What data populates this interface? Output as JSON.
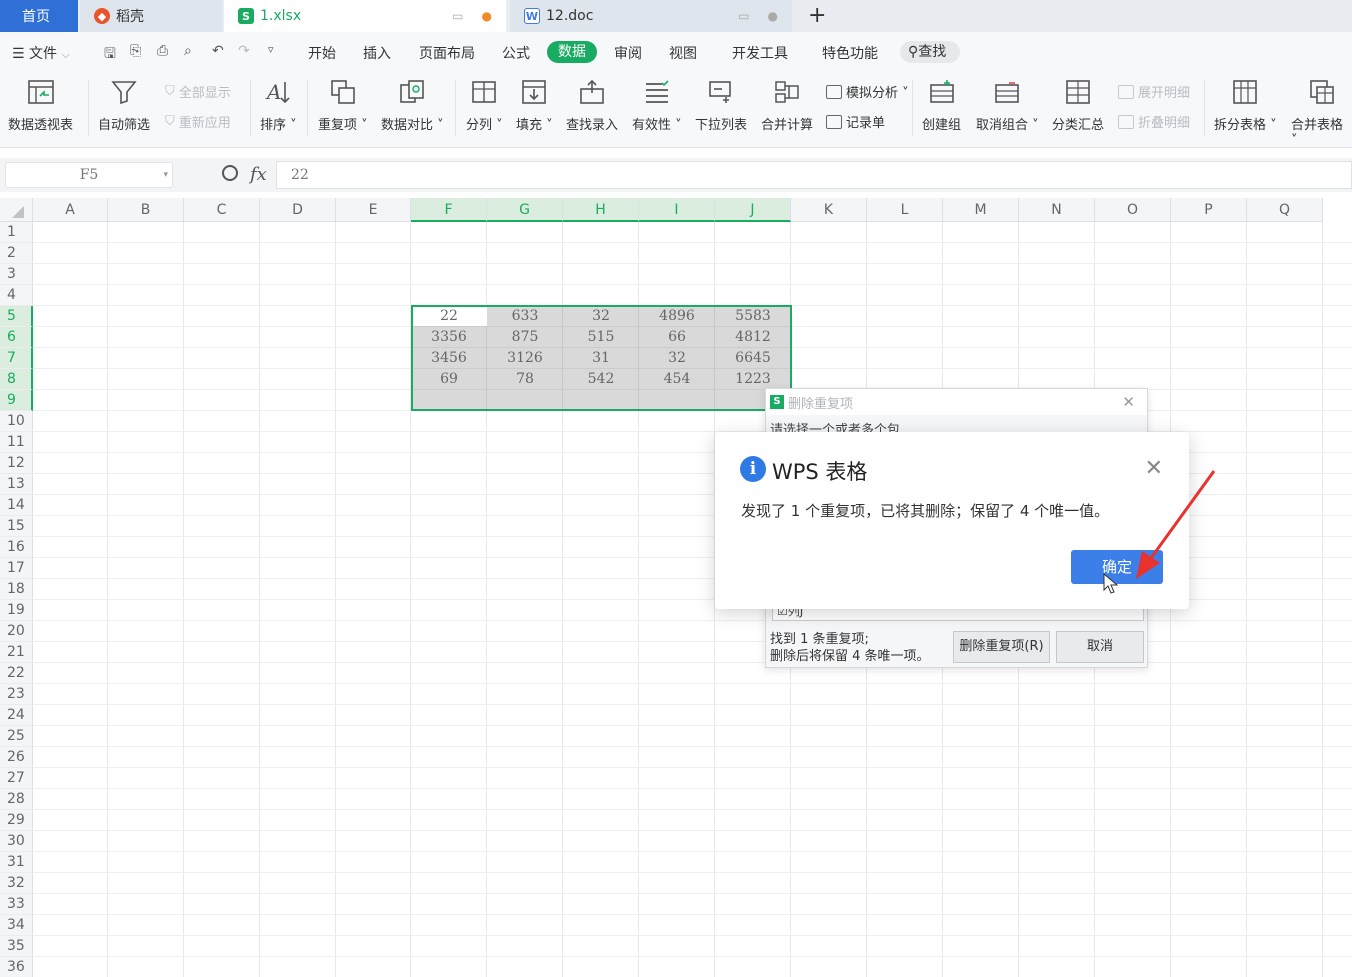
{
  "tabs": {
    "home": "首页",
    "daoke": "稻壳",
    "xlsx": "1.xlsx",
    "doc": "12.doc",
    "add": "+"
  },
  "menu": {
    "file": "文件",
    "items": [
      "开始",
      "插入",
      "页面布局",
      "公式",
      "数据",
      "审阅",
      "视图",
      "开发工具",
      "特色功能"
    ],
    "search": "查找"
  },
  "ribbon": {
    "pivot": "数据透视表",
    "autofilter": "自动筛选",
    "show_all": "全部显示",
    "reapply": "重新应用",
    "sort": "排序",
    "duplicates": "重复项",
    "compare": "数据对比",
    "split_col": "分列",
    "fill": "填充",
    "lookup_entry": "查找录入",
    "validity": "有效性",
    "dropdown": "下拉列表",
    "consolidate": "合并计算",
    "simulate": "模拟分析",
    "record": "记录单",
    "group": "创建组",
    "ungroup": "取消组合",
    "subtotal": "分类汇总",
    "expand": "展开明细",
    "collapse": "折叠明细",
    "split_table": "拆分表格",
    "merge_table": "合并表格"
  },
  "formula_bar": {
    "cell_ref": "F5",
    "fx": "fx",
    "value": "22"
  },
  "columns": [
    "A",
    "B",
    "C",
    "D",
    "E",
    "F",
    "G",
    "H",
    "I",
    "J",
    "K",
    "L",
    "M",
    "N",
    "O",
    "P",
    "Q"
  ],
  "selected_columns": [
    "F",
    "G",
    "H",
    "I",
    "J"
  ],
  "rows": [
    "1",
    "2",
    "3",
    "4",
    "5",
    "6",
    "7",
    "8",
    "9",
    "10",
    "11",
    "12",
    "13",
    "14",
    "15",
    "16",
    "17",
    "18",
    "19",
    "20",
    "21",
    "22",
    "23",
    "24",
    "25",
    "26",
    "27",
    "28",
    "29",
    "30",
    "31",
    "32",
    "33",
    "34",
    "35",
    "36"
  ],
  "cells": [
    [
      "22",
      "633",
      "32",
      "4896",
      "5583"
    ],
    [
      "3356",
      "875",
      "515",
      "66",
      "4812"
    ],
    [
      "3456",
      "3126",
      "31",
      "32",
      "6645"
    ],
    [
      "69",
      "78",
      "542",
      "454",
      "1223"
    ]
  ],
  "dup_dialog": {
    "title": "删除重复项",
    "instruction": "请选择一个或者多个包",
    "column_option": "列J",
    "found_line1": "找到 1 条重复项;",
    "found_line2": "删除后将保留 4 条唯一项。",
    "delete_button": "删除重复项(R)",
    "cancel_button": "取消"
  },
  "message_box": {
    "title": "WPS 表格",
    "message": "发现了 1 个重复项，已将其删除；保留了 4 个唯一值。",
    "ok_button": "确定"
  },
  "colors": {
    "accent_green": "#1aab63",
    "home_tab": "#2f6fd6",
    "ok_button": "#3c7fe8",
    "arrow": "#e8322e"
  }
}
